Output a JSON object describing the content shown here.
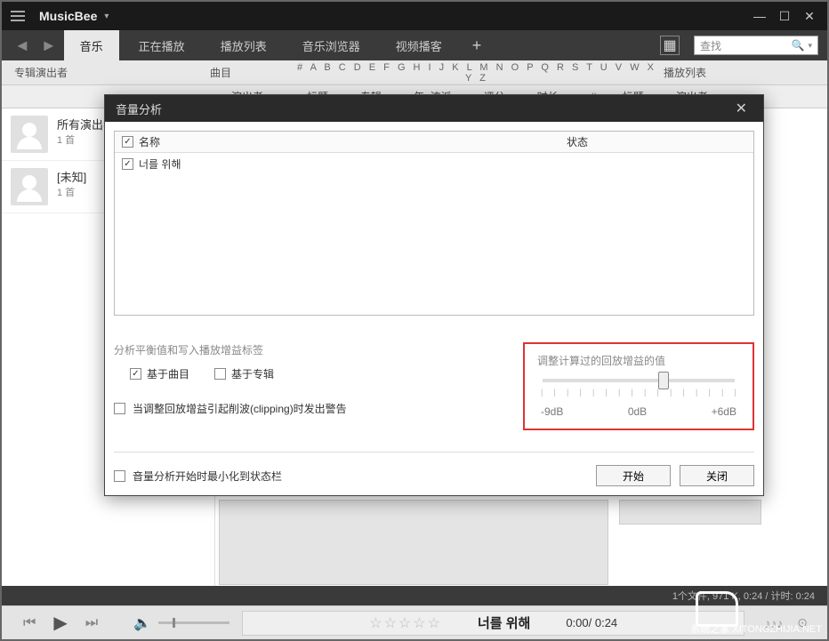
{
  "app": {
    "title": "MusicBee"
  },
  "toolbar": {
    "tabs": [
      "音乐",
      "正在播放",
      "播放列表",
      "音乐浏览器",
      "视频播客"
    ],
    "search_placeholder": "查找"
  },
  "header": {
    "album_artist": "专辑演出者",
    "track": "曲目",
    "alpha": "# A B C D E F G H I J K L M N O P Q R S T U V W X Y Z",
    "playlist": "播放列表"
  },
  "columns": {
    "artist": "演出者",
    "title": "标题",
    "album": "专辑",
    "year_genre": "年, 流派",
    "rating": "评分",
    "duration": "时长",
    "num": "#",
    "title2": "标题",
    "artist2": "演出者"
  },
  "artists": [
    {
      "name": "所有演出者",
      "count": "1 首"
    },
    {
      "name": "[未知]",
      "count": "1 首"
    }
  ],
  "modal": {
    "title": "音量分析",
    "list_header_name": "名称",
    "list_header_status": "状态",
    "list_rows": [
      {
        "name": "너를 위해"
      }
    ],
    "analyze_label": "分析平衡值和写入播放增益标签",
    "by_track": "基于曲目",
    "by_album": "基于专辑",
    "clipping_warn": "当调整回放增益引起削波(clipping)时发出警告",
    "gain_label": "调整计算过的回放增益的值",
    "gain_ticks": {
      "left": "-9dB",
      "mid": "0dB",
      "right": "+6dB"
    },
    "minimize_label": "音量分析开始时最小化到状态栏",
    "btn_start": "开始",
    "btn_close": "关闭"
  },
  "status": "1个文件, 971 K, 0:24 /    计时: 0:24",
  "player": {
    "stars": "☆☆☆☆☆",
    "title": "너를 위해",
    "time": "0:00/ 0:24"
  },
  "watermark": "系统之家\nXITONGZHIJIA.NET"
}
